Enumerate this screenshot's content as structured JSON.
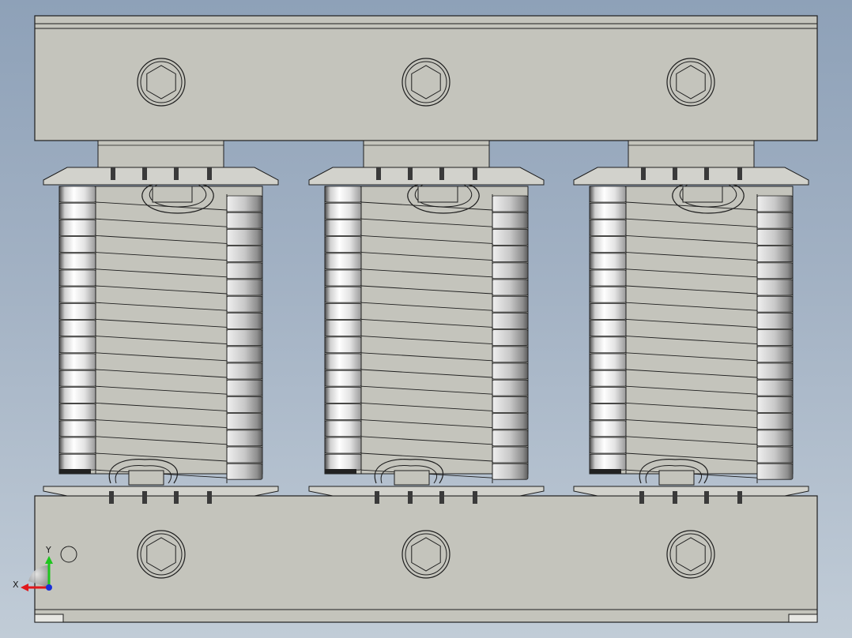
{
  "viewport": {
    "background_top": "#8ea1b8",
    "background_bottom": "#c1ccd7"
  },
  "model": {
    "name": "three-phase-reactor",
    "body_color": "#c4c4bc",
    "edge_color": "#1e1e1e",
    "coil_count": 3,
    "top_yoke_bolts": 3,
    "bottom_yoke_bolts": 3
  },
  "triad": {
    "x_label": "X",
    "y_label": "Y",
    "x_color": "#e0181c",
    "y_color": "#1ec51e",
    "z_color": "#1a2fd8"
  }
}
